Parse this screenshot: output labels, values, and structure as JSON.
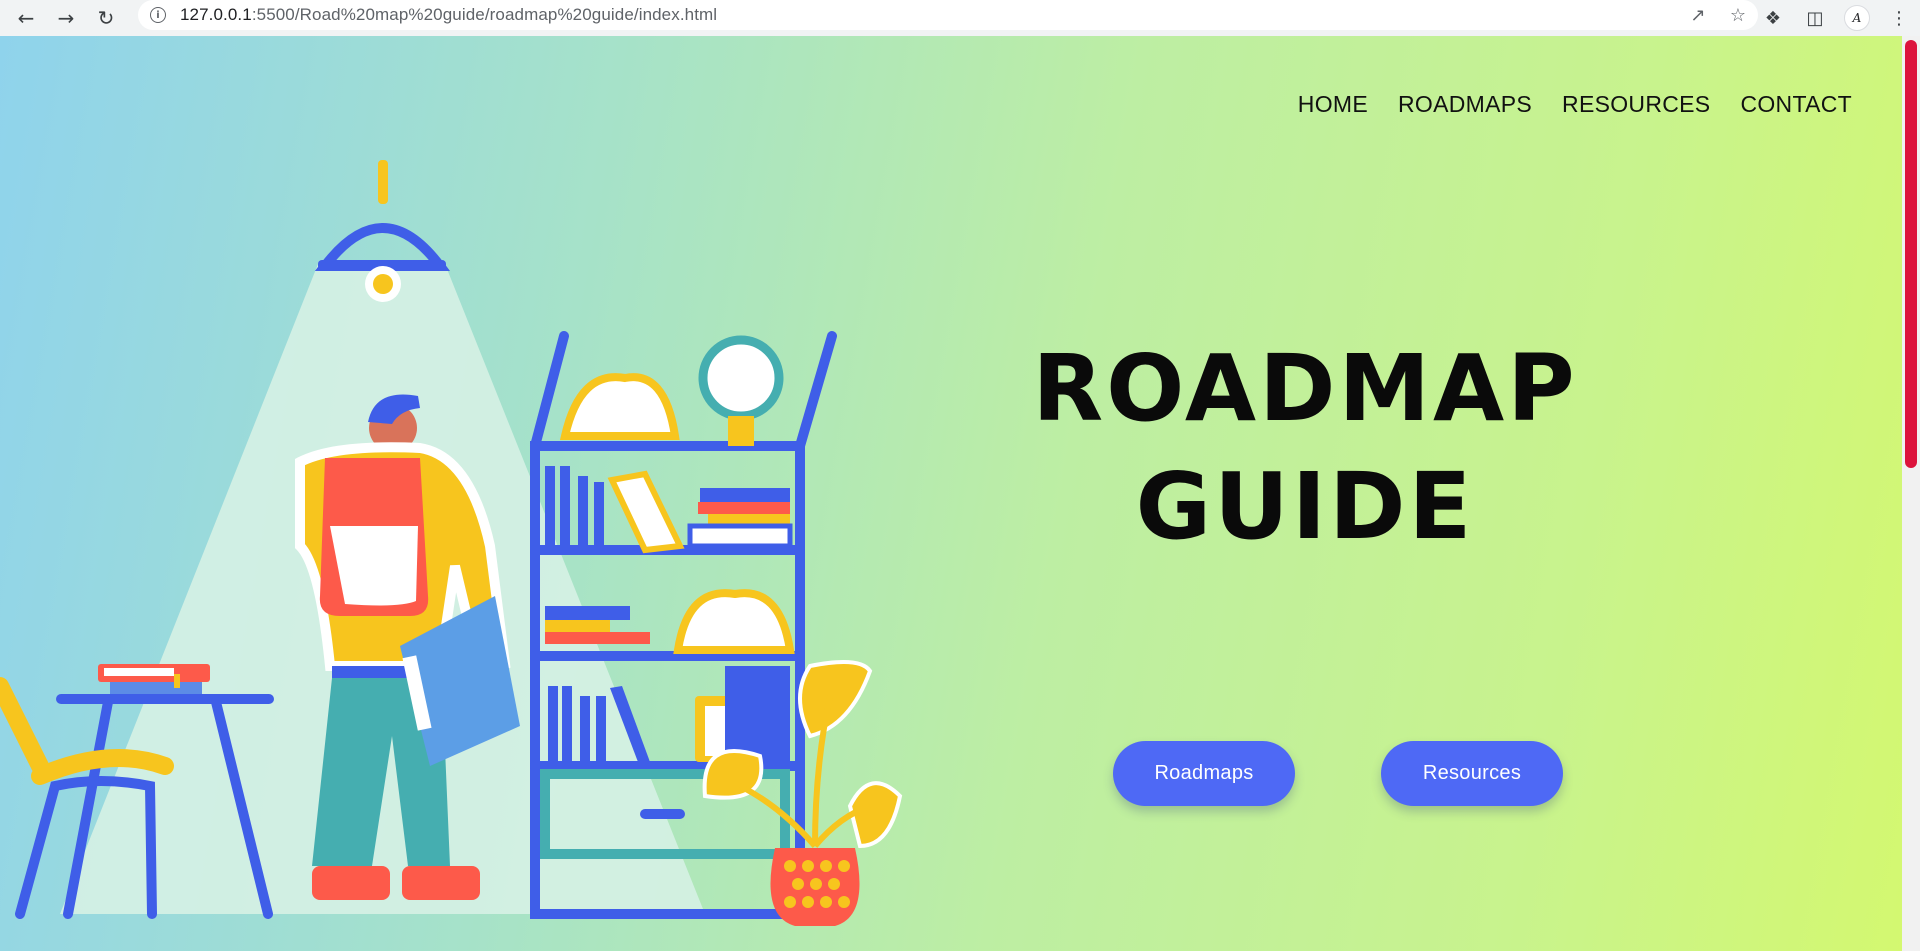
{
  "browser": {
    "url_host": "127.0.0.1",
    "url_rest": ":5500/Road%20map%20guide/roadmap%20guide/index.html",
    "avatar_text": "A"
  },
  "icons": {
    "back": "arrow-left-icon",
    "forward": "arrow-right-icon",
    "reload": "reload-icon",
    "info": "info-icon",
    "share": "share-icon",
    "star": "star-icon",
    "extensions": "puzzle-icon",
    "side_panel": "side-panel-icon",
    "menu": "kebab-menu-icon"
  },
  "nav": {
    "items": [
      {
        "label": "HOME"
      },
      {
        "label": "ROADMAPS"
      },
      {
        "label": "RESOURCES"
      },
      {
        "label": "CONTACT"
      }
    ]
  },
  "hero": {
    "title_line1": "ROADMAP",
    "title_line2": "GUIDE"
  },
  "buttons": {
    "roadmaps": "Roadmaps",
    "resources": "Resources"
  },
  "colors": {
    "accent": "#4e69f5",
    "scrollbar": "#dc143c",
    "gradient_start": "#8fd3ec",
    "gradient_end": "#d4f86f"
  }
}
